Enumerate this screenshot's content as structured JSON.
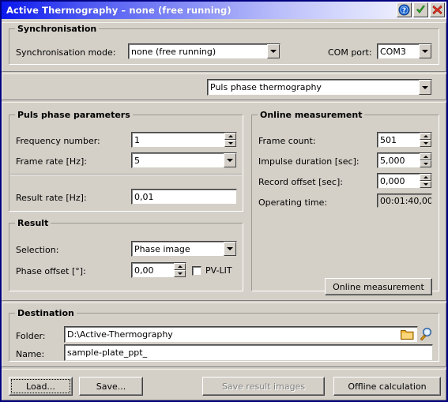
{
  "window": {
    "title": "Active Thermography – none (free running)",
    "title_buttons": [
      {
        "name": "help-button",
        "icon": "question-circle-icon"
      },
      {
        "name": "ok-button",
        "icon": "check-icon"
      },
      {
        "name": "close-button",
        "icon": "close-x-icon"
      }
    ]
  },
  "synchronisation": {
    "legend": "Synchronisation",
    "mode_label": "Synchronisation mode:",
    "mode_value": "none (free running)",
    "com_label": "COM port:",
    "com_value": "COM3"
  },
  "method": {
    "value": "Puls phase thermography"
  },
  "puls_phase": {
    "legend": "Puls phase parameters",
    "frequency_label": "Frequency number:",
    "frequency_value": "1",
    "frame_rate_label": "Frame rate [Hz]:",
    "frame_rate_value": "5",
    "result_rate_label": "Result rate [Hz]:",
    "result_rate_value": "0,01"
  },
  "online": {
    "legend": "Online measurement",
    "frame_count_label": "Frame count:",
    "frame_count_value": "501",
    "impulse_label": "Impulse duration [sec]:",
    "impulse_value": "5,000",
    "record_offset_label": "Record offset [sec]:",
    "record_offset_value": "0,000",
    "operating_time_label": "Operating time:",
    "operating_time_value": "00:01:40,00",
    "button_label": "Online measurement"
  },
  "result": {
    "legend": "Result",
    "selection_label": "Selection:",
    "selection_value": "Phase image",
    "phase_offset_label": "Phase offset [°]:",
    "phase_offset_value": "0,00",
    "pvlit_label": "PV-LIT",
    "pvlit_checked": false
  },
  "destination": {
    "legend": "Destination",
    "folder_label": "Folder:",
    "folder_value": "D:\\Active-Thermography",
    "name_label": "Name:",
    "name_value": "sample-plate_ppt_"
  },
  "footer": {
    "load_label": "Load...",
    "save_label": "Save...",
    "save_results_label": "Save result images",
    "offline_label": "Offline calculation"
  },
  "colors": {
    "title_start": "#0a18ef",
    "title_end": "#fdfdff",
    "window_border": "#000080",
    "face": "#d4d0c8",
    "disabled_text": "#808080",
    "folder_icon": "#e8a317",
    "check_green": "#2fa32f",
    "close_red": "#e03020"
  }
}
